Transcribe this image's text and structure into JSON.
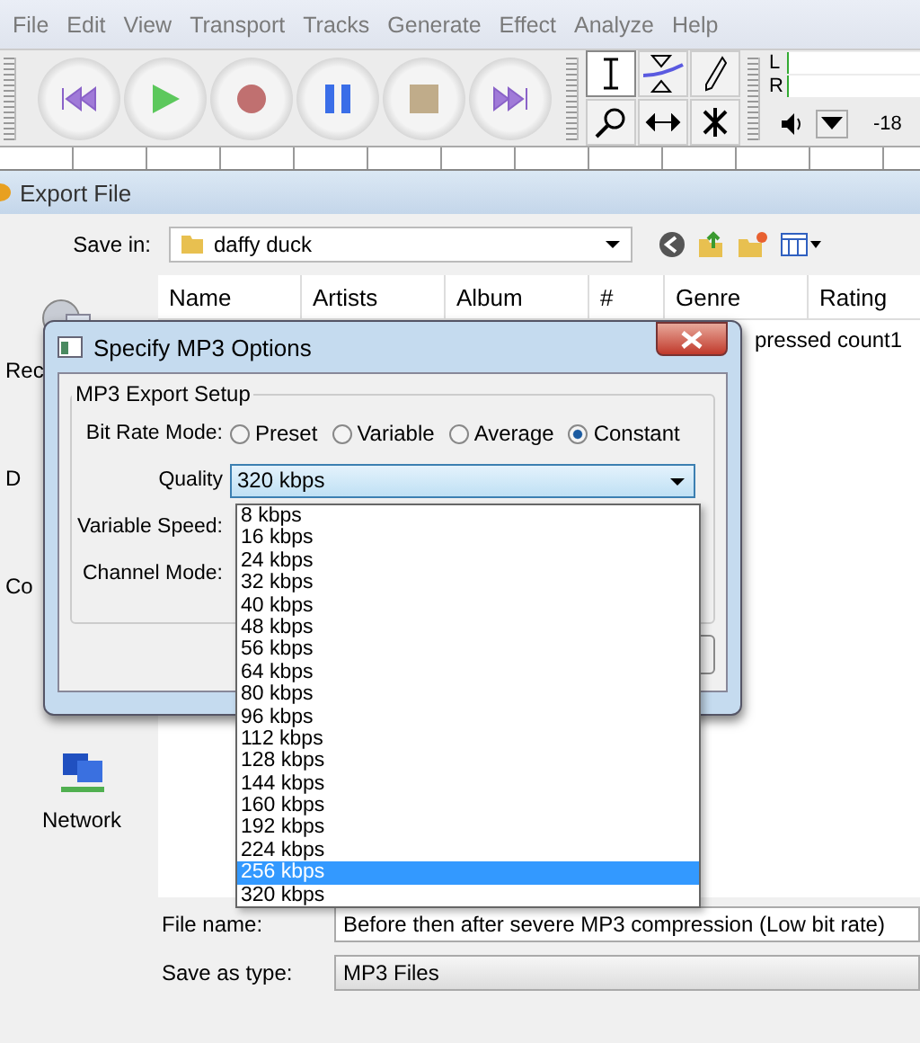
{
  "menu": [
    "File",
    "Edit",
    "View",
    "Transport",
    "Tracks",
    "Generate",
    "Effect",
    "Analyze",
    "Help"
  ],
  "meter": {
    "left": "L",
    "right": "R",
    "reading": "-18"
  },
  "export_dialog": {
    "title": "Export File",
    "save_in_label": "Save in:",
    "save_in": "daffy duck",
    "sidebar": [
      {
        "label": "Rec",
        "kind": "recent"
      },
      {
        "label": "D",
        "kind": "plain"
      },
      {
        "label": "Co",
        "kind": "plain"
      },
      {
        "label": "Network",
        "kind": "network"
      }
    ],
    "columns": [
      "Name",
      "Artists",
      "Album",
      "#",
      "Genre",
      "Rating"
    ],
    "rows": [
      "pressed count1"
    ],
    "file_name_label": "File name:",
    "file_name": "Before then after severe MP3 compression (Low bit rate)",
    "type_label": "Save as type:",
    "type": "MP3 Files"
  },
  "mp3_dialog": {
    "title": "Specify MP3 Options",
    "group": "MP3 Export Setup",
    "bit_rate_label": "Bit Rate Mode:",
    "modes": [
      {
        "label": "Preset",
        "selected": false
      },
      {
        "label": "Variable",
        "selected": false
      },
      {
        "label": "Average",
        "selected": false
      },
      {
        "label": "Constant",
        "selected": true
      }
    ],
    "quality_label": "Quality",
    "quality": "320 kbps",
    "speed_label": "Variable Speed:",
    "channel_label": "Channel Mode:",
    "options": [
      {
        "label": "8 kbps",
        "selected": false
      },
      {
        "label": "16 kbps",
        "selected": false
      },
      {
        "label": "24 kbps",
        "selected": false
      },
      {
        "label": "32 kbps",
        "selected": false
      },
      {
        "label": "40 kbps",
        "selected": false
      },
      {
        "label": "48 kbps",
        "selected": false
      },
      {
        "label": "56 kbps",
        "selected": false
      },
      {
        "label": "64 kbps",
        "selected": false
      },
      {
        "label": "80 kbps",
        "selected": false
      },
      {
        "label": "96 kbps",
        "selected": false
      },
      {
        "label": "112 kbps",
        "selected": false
      },
      {
        "label": "128 kbps",
        "selected": false
      },
      {
        "label": "144 kbps",
        "selected": false
      },
      {
        "label": "160 kbps",
        "selected": false
      },
      {
        "label": "192 kbps",
        "selected": false
      },
      {
        "label": "224 kbps",
        "selected": false
      },
      {
        "label": "256 kbps",
        "selected": true
      },
      {
        "label": "320 kbps",
        "selected": false
      }
    ]
  }
}
